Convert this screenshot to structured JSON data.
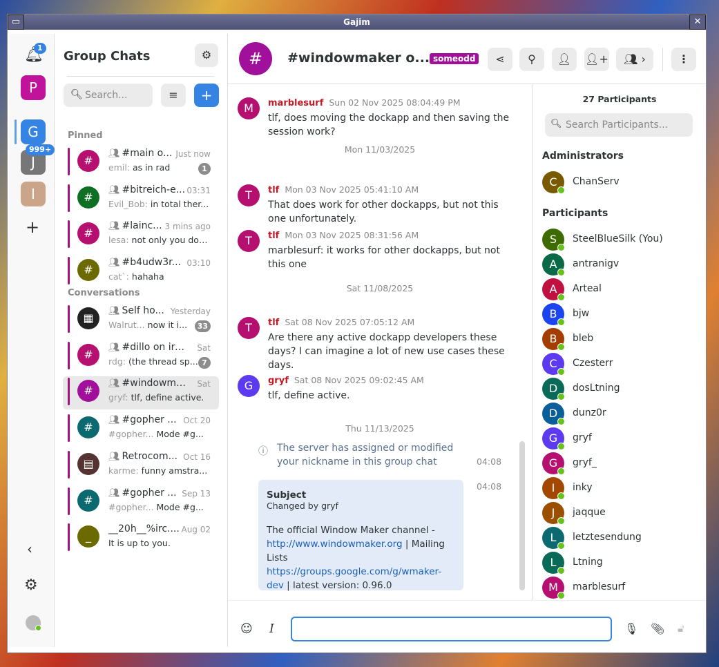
{
  "window": {
    "title": "Gajim",
    "menu_icon": "window-menu-icon",
    "close_icon": "close-icon"
  },
  "rail": {
    "notif_count": "1",
    "accounts": [
      {
        "letter": "P",
        "color": "#c0129a"
      },
      {
        "letter": "G",
        "color": "#3584e4"
      },
      {
        "letter": "J",
        "color": "#777777",
        "badge": "999+"
      },
      {
        "letter": "I",
        "color": "#caa58a"
      }
    ]
  },
  "sidebar": {
    "title": "Group Chats",
    "search_placeholder": "Search...",
    "pinned_label": "Pinned",
    "conversations_label": "Conversations",
    "pinned": [
      {
        "name": "#main o...",
        "time": "Just now",
        "nick": "emil:",
        "text": "as in rad",
        "count": "1",
        "color": "#b5106f"
      },
      {
        "name": "#bitreich-e...",
        "time": "03:31",
        "nick": "Evil_Bob:",
        "text": "in total ther...",
        "color": "#0f7024"
      },
      {
        "name": "#lainc...",
        "time": "3 mins ago",
        "nick": "lesa:",
        "text": "not only you don...",
        "color": "#b5106f"
      },
      {
        "name": "#b4udw3r...",
        "time": "03:10",
        "nick": "cat`:",
        "text": "hahaha",
        "color": "#6b6a00"
      }
    ],
    "conversations": [
      {
        "name": "Self ho...",
        "time": "Yesterday",
        "nick": "Walrut...",
        "text": "now it i...",
        "count": "33",
        "color": "#222222",
        "letter": "▦"
      },
      {
        "name": "#dillo on irc.l...",
        "time": "Sat",
        "nick": "rdg:",
        "text": "(the thread sp...",
        "count": "7",
        "color": "#b5106f"
      },
      {
        "name": "#windowma...",
        "time": "Sat",
        "nick": "gryf:",
        "text": "tlf, define active.",
        "color": "#a0109a",
        "selected": true
      },
      {
        "name": "#gopher ...",
        "time": "Oct 20",
        "nick": "#gopher...",
        "text": "Mode #g...",
        "color": "#0a6a70"
      },
      {
        "name": "Retrocom...",
        "time": "Oct 16",
        "nick": "karme:",
        "text": "funny amstra...",
        "color": "#553333",
        "letter": "▤"
      },
      {
        "name": "#gopher ...",
        "time": "Sep 13",
        "nick": "#gopher...",
        "text": "Mode #g...",
        "color": "#0a6a70"
      },
      {
        "name": "__20h__%irc....",
        "time": "Aug 02",
        "nick": "",
        "text": "It is up to you.",
        "color": "#6b6a00",
        "letter": "_",
        "nogroup": true
      }
    ]
  },
  "header": {
    "title": "#windowmaker o...",
    "nick_badge": "someodd",
    "badge_color": "#a0109a"
  },
  "messages": [
    {
      "type": "msg",
      "author": "marblesurf",
      "letter": "M",
      "color": "#b5106f",
      "time": "Sun 02 Nov 2025 08:04:49 PM",
      "text": "tlf, does moving the dockapp and then saving the session work?"
    },
    {
      "type": "date",
      "text": "Mon 11/03/2025"
    },
    {
      "type": "msg",
      "author": "tlf",
      "letter": "T",
      "color": "#b5106f",
      "time": "Mon 03 Nov 2025 05:41:10 AM",
      "text": "That does work for other dockapps, but not this one unfortunately."
    },
    {
      "type": "msg",
      "author": "tlf",
      "letter": "T",
      "color": "#b5106f",
      "time": "Mon 03 Nov 2025 08:31:56 AM",
      "text": "marblesurf: it works for other dockapps, but not this one"
    },
    {
      "type": "date",
      "text": "Sat 11/08/2025"
    },
    {
      "type": "msg",
      "author": "tlf",
      "letter": "T",
      "color": "#b5106f",
      "time": "Sat 08 Nov 2025 07:05:12 AM",
      "text": "Are there any active dockapp developers these days? I can imagine a lot of new use cases these days."
    },
    {
      "type": "msg",
      "author": "gryf",
      "letter": "G",
      "color": "#5b3af0",
      "time": "Sat 08 Nov 2025 09:02:45 AM",
      "text": "tlf, define active."
    },
    {
      "type": "date",
      "text": "Thu 11/13/2025"
    }
  ],
  "info": {
    "text": "The server has assigned or modified your nickname in this group chat",
    "time": "04:08"
  },
  "subject": {
    "title": "Subject",
    "by": "Changed by gryf",
    "time": "04:08",
    "t1": "The official Window Maker channel - ",
    "link1": "http://www.windowmaker.org",
    "t2": " | Mailing Lists ",
    "link2": "https://groups.google.com/g/wmaker-dev",
    "t3": " | latest version: 0.96.0"
  },
  "participants": {
    "count_label": "27 Participants",
    "search_placeholder": "Search Participants...",
    "admins_label": "Administrators",
    "participants_label": "Participants",
    "admins": [
      {
        "name": "ChanServ",
        "letter": "C",
        "color": "#7a5a00"
      }
    ],
    "list": [
      {
        "name": "SteelBlueSilk (You)",
        "letter": "S",
        "color": "#3e6b00"
      },
      {
        "name": "antranigv",
        "letter": "A",
        "color": "#0a6a48"
      },
      {
        "name": "Arteal",
        "letter": "A",
        "color": "#c0103f"
      },
      {
        "name": "bjw",
        "letter": "B",
        "color": "#1c44f0"
      },
      {
        "name": "bleb",
        "letter": "B",
        "color": "#a33e00"
      },
      {
        "name": "Czesterr",
        "letter": "C",
        "color": "#5b3af0"
      },
      {
        "name": "dosLtning",
        "letter": "D",
        "color": "#0a6a58"
      },
      {
        "name": "dunz0r",
        "letter": "D",
        "color": "#0a5f9a"
      },
      {
        "name": "gryf",
        "letter": "G",
        "color": "#5b3af0"
      },
      {
        "name": "gryf_",
        "letter": "G",
        "color": "#b5106f"
      },
      {
        "name": "inky",
        "letter": "I",
        "color": "#a34800"
      },
      {
        "name": "jaqque",
        "letter": "J",
        "color": "#9a5000"
      },
      {
        "name": "letztesendung",
        "letter": "L",
        "color": "#0a6a70"
      },
      {
        "name": "Ltning",
        "letter": "L",
        "color": "#0a6a58"
      },
      {
        "name": "marblesurf",
        "letter": "M",
        "color": "#b5106f"
      }
    ]
  },
  "composer": {
    "value": ""
  }
}
